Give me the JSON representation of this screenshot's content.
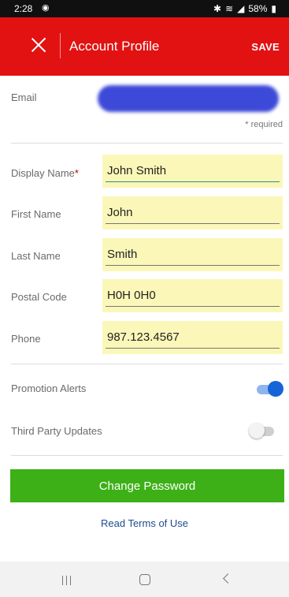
{
  "status_bar": {
    "time": "2:28",
    "notification_icon": "notification-icon",
    "battery": "58%",
    "icons": [
      "bluetooth-icon",
      "wifi-icon",
      "signal-icon"
    ]
  },
  "app_bar": {
    "title": "Account Profile",
    "save_label": "SAVE",
    "close_icon": "close-icon",
    "color": "#e21212"
  },
  "email": {
    "label": "Email",
    "value_redacted": true
  },
  "required_note": "* required",
  "fields": [
    {
      "label": "Display Name",
      "required_mark": "*",
      "value": "John Smith",
      "active": true
    },
    {
      "label": "First Name",
      "value": "John"
    },
    {
      "label": "Last Name",
      "value": "Smith"
    },
    {
      "label": "Postal Code",
      "value": "H0H 0H0"
    },
    {
      "label": "Phone",
      "value": "987.123.4567"
    }
  ],
  "toggles": [
    {
      "label": "Promotion Alerts",
      "on": true
    },
    {
      "label": "Third Party Updates",
      "on": false
    }
  ],
  "change_password_label": "Change Password",
  "terms_link": "Read Terms of Use",
  "nav_bar": {
    "recent_icon": "recent-apps-icon",
    "home_icon": "home-icon",
    "back_icon": "back-icon"
  },
  "colors": {
    "primary": "#e21212",
    "button": "#3db017",
    "field_bg": "#fbf7b8",
    "toggle_on": "#1565d8",
    "link": "#1e4b8f"
  }
}
